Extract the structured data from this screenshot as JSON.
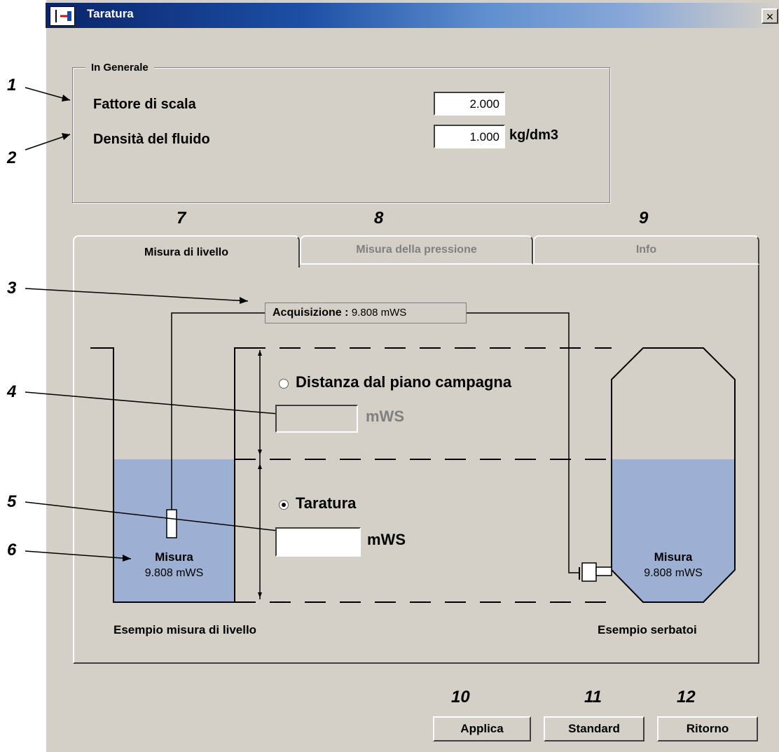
{
  "window": {
    "title": "Taratura",
    "close_glyph": "×"
  },
  "general": {
    "legend": "In Generale",
    "scale_label": "Fattore di scala",
    "scale_value": "2.000",
    "density_label": "Densità del fluido",
    "density_value": "1.000",
    "density_unit": "kg/dm3"
  },
  "tabs": [
    {
      "label": "Misura di livello",
      "active": true
    },
    {
      "label": "Misura della pressione",
      "active": false
    },
    {
      "label": "Info",
      "active": false
    }
  ],
  "level": {
    "acquisition_label": "Acquisizione :",
    "acquisition_value": "9.808 mWS",
    "distance_label": "Distanza dal piano campagna",
    "distance_value": "",
    "distance_unit": "mWS",
    "calibration_label": "Taratura",
    "calibration_value": "",
    "calibration_unit": "mWS",
    "well_measure_label": "Misura",
    "well_measure_value": "9.808 mWS",
    "tank_measure_label": "Misura",
    "tank_measure_value": "9.808 mWS",
    "example_level": "Esempio misura di livello",
    "example_tank": "Esempio serbatoi"
  },
  "buttons": {
    "apply": "Applica",
    "standard": "Standard",
    "return": "Ritorno"
  },
  "annotations": {
    "n1": "1",
    "n2": "2",
    "n3": "3",
    "n4": "4",
    "n5": "5",
    "n6": "6",
    "n7": "7",
    "n8": "8",
    "n9": "9",
    "n10": "10",
    "n11": "11",
    "n12": "12"
  },
  "colors": {
    "title_start": "#0a246a",
    "dialog_bg": "#d4d0c8",
    "water": "#9db0d3",
    "disabled_text": "#808080"
  }
}
